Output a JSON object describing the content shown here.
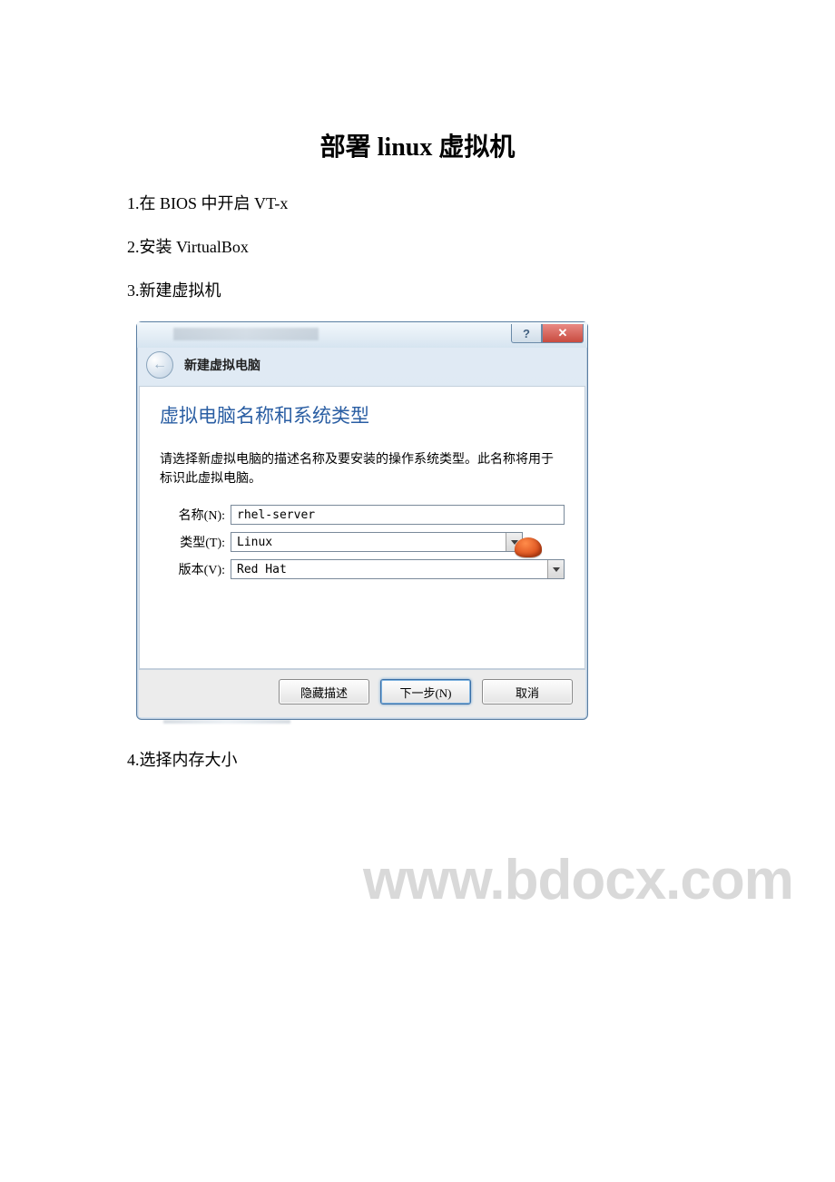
{
  "doc": {
    "title": "部署 linux 虚拟机",
    "steps": [
      "1.在 BIOS 中开启 VT-x",
      "2.安装 VirtualBox",
      "3.新建虚拟机",
      "4.选择内存大小"
    ]
  },
  "watermark": "www.bdocx.com",
  "dialog": {
    "help_symbol": "?",
    "close_symbol": "✕",
    "wizard_title": "新建虚拟电脑",
    "back_arrow": "←",
    "section_heading": "虚拟电脑名称和系统类型",
    "description": "请选择新虚拟电脑的描述名称及要安装的操作系统类型。此名称将用于标识此虚拟电脑。",
    "labels": {
      "name": "名称(N):",
      "type": "类型(T):",
      "version": "版本(V):"
    },
    "fields": {
      "name_value": "rhel-server",
      "type_value": "Linux",
      "version_value": "Red Hat"
    },
    "buttons": {
      "hide_desc": "隐藏描述",
      "next": "下一步(N)",
      "cancel": "取消"
    }
  }
}
